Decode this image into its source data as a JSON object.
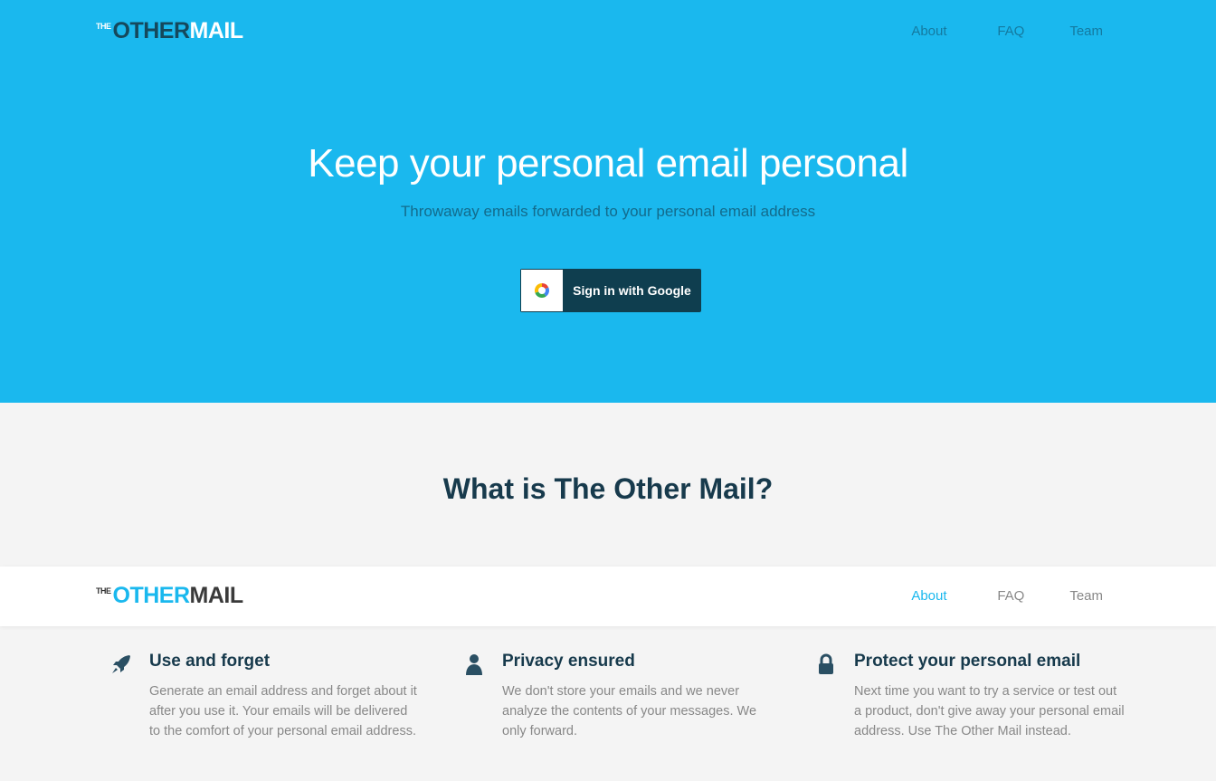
{
  "brand": {
    "the": "THE",
    "word1": "OTHER",
    "word2": "MAIL"
  },
  "nav": [
    {
      "label": "About"
    },
    {
      "label": "FAQ"
    },
    {
      "label": "Team"
    }
  ],
  "hero": {
    "title": "Keep your personal email personal",
    "subtitle": "Throwaway emails forwarded to your personal email address",
    "google_button_label": "Sign in with Google"
  },
  "what_is": {
    "title": "What is The Other Mail?"
  },
  "features": [
    {
      "icon": "rocket-icon",
      "title": "Use and forget",
      "text": "Generate an email address and forget about it after you use it. Your emails will be delivered to the comfort of your personal email address."
    },
    {
      "icon": "user-icon",
      "title": "Privacy ensured",
      "text": "We don't store your emails and we never analyze the contents of your messages. We only forward."
    },
    {
      "icon": "lock-icon",
      "title": "Protect your personal email",
      "text": "Next time you want to try a service or test out a product, don't give away your personal email address. Use The Other Mail instead."
    }
  ],
  "colors": {
    "hero_bg": "#1ab8ee",
    "dark_navy": "#173a4c",
    "button_bg": "#0f3e4f",
    "section_bg": "#f4f4f4",
    "active_nav": "#1ab8ee"
  }
}
